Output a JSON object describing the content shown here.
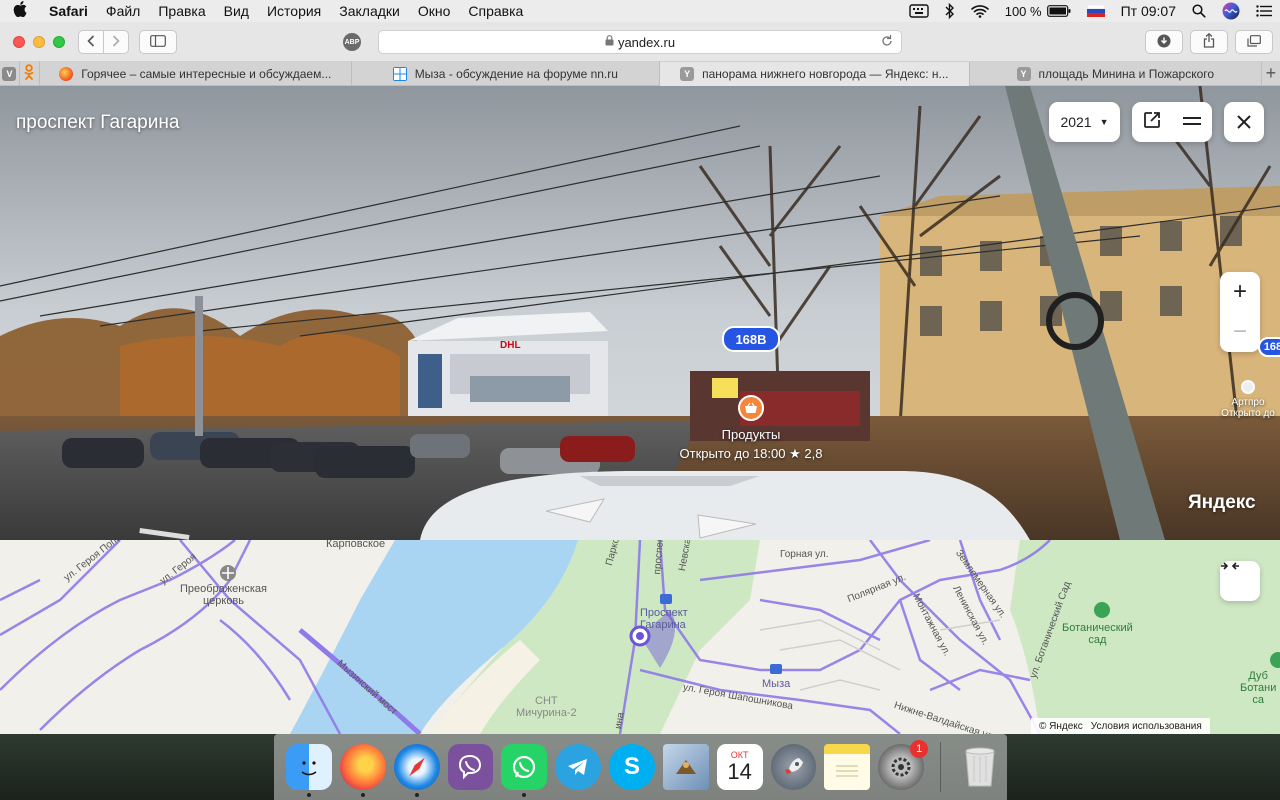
{
  "menubar": {
    "apple": "",
    "app": "Safari",
    "items": [
      "Файл",
      "Правка",
      "Вид",
      "История",
      "Закладки",
      "Окно",
      "Справка"
    ],
    "battery": "100 %",
    "clock": "Пт 09:07"
  },
  "toolbar": {
    "url": "yandex.ru",
    "abp": "ABP"
  },
  "tabs": [
    {
      "title": "Горячее – самые интересные и обсуждаем...",
      "favicon_color": "#f4602a"
    },
    {
      "title": "Мыза - обсуждение на форуме nn.ru",
      "favicon_color": "#1e88e5"
    },
    {
      "title": "панорама нижнего новгорода — Яндекс: н...",
      "favicon_color": "#9a9a9a"
    },
    {
      "title": "площадь Минина и Пожарского",
      "favicon_color": "#9a9a9a"
    }
  ],
  "pinned": [
    "V",
    "ok"
  ],
  "panorama": {
    "street": "проспект Гагарина",
    "year": "2021",
    "bus_badge": "168В",
    "bus_badge_edge": "168",
    "poi": {
      "name": "Продукты",
      "hours": "Открыто до 18:00",
      "rating": "★ 2,8"
    },
    "poi_edge": {
      "name": "Артпро",
      "hours": "Открыто до"
    },
    "logo": "Яндекс"
  },
  "map": {
    "labels": {
      "karpovskoe": "Карповское",
      "geroya_popova": "ул. Героя Попова",
      "geroya": "ул. Героя",
      "church": "Преображенская\nцерковь",
      "myzinsky_bridge": "Мызинский мост",
      "parkovaya": "Парковы",
      "prospekt": "проспект",
      "nevskaya": "Невска",
      "station": "Проспект\nГагарина",
      "gornaya": "Горная ул.",
      "polyarnaya": "Полярная ул.",
      "montazhnaya": "Монтажная ул.",
      "leninskaya": "Ленинская ул.",
      "zemlemernaya": "Землемерная ул.",
      "botanical_street": "ул. Ботанический Сад",
      "botanical_garden": "Ботанический\nсад",
      "dub": "Дуб\nБотани\nса",
      "myza": "Мыза",
      "snt": "СНТ\nМичурина-2",
      "shaposhnikova": "ул. Героя Шапошникова",
      "valdaiskaya": "Нижне-Валдайская ул.",
      "vertical_street": "ина"
    },
    "copyright": "© Яндекс",
    "terms": "Условия использования"
  },
  "dock": [
    {
      "name": "finder",
      "color": "#1e88e5",
      "running": true
    },
    {
      "name": "firefox",
      "color": "#ff7139",
      "running": true
    },
    {
      "name": "safari",
      "color": "#1e88e5",
      "running": true
    },
    {
      "name": "viber",
      "color": "#7b519d",
      "running": false
    },
    {
      "name": "whatsapp",
      "color": "#25d366",
      "running": true
    },
    {
      "name": "telegram",
      "color": "#2aa3e0",
      "running": false
    },
    {
      "name": "skype",
      "color": "#00aff0",
      "running": false
    },
    {
      "name": "mail",
      "color": "#8aa7c7",
      "running": false
    },
    {
      "name": "calendar",
      "color": "#ffffff",
      "running": false,
      "month": "ОКТ",
      "day": "14"
    },
    {
      "name": "launchpad",
      "color": "#6b7280",
      "running": false
    },
    {
      "name": "notes",
      "color": "#f7d84a",
      "running": false
    },
    {
      "name": "system-preferences",
      "color": "#7d7d7d",
      "running": false,
      "badge": "1"
    }
  ]
}
